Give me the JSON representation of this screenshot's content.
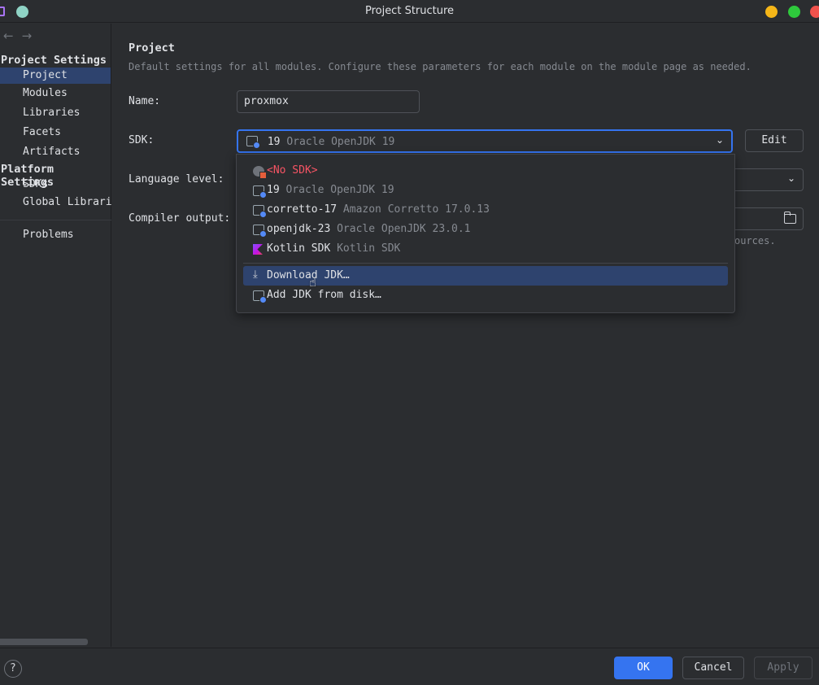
{
  "window": {
    "title": "Project Structure"
  },
  "sidebar": {
    "nav_back": "←",
    "nav_forward": "→",
    "project_settings_header": "Project Settings",
    "project_settings_items": [
      "Project",
      "Modules",
      "Libraries",
      "Facets",
      "Artifacts"
    ],
    "platform_settings_header": "Platform Settings",
    "platform_settings_items": [
      "SDKs",
      "Global Librari"
    ],
    "problems": "Problems",
    "selected": "Project"
  },
  "main": {
    "heading": "Project",
    "description": "Default settings for all modules. Configure these parameters for each module on the module page as needed.",
    "name_label": "Name:",
    "name_value": "proxmox",
    "sdk_label": "SDK:",
    "sdk_value_name": "19",
    "sdk_value_detail": "Oracle OpenJDK 19",
    "edit_label": "Edit",
    "language_level_label": "Language level:",
    "compiler_output_label": "Compiler output:",
    "compiler_output_hint_tail": "ources."
  },
  "sdk_dropdown": {
    "items": [
      {
        "name": "<No SDK>",
        "detail": "",
        "icon": "no-sdk-icon"
      },
      {
        "name": "19",
        "detail": "Oracle OpenJDK 19",
        "icon": "jdk-icon"
      },
      {
        "name": "corretto-17",
        "detail": "Amazon Corretto 17.0.13",
        "icon": "jdk-icon"
      },
      {
        "name": "openjdk-23",
        "detail": "Oracle OpenJDK 23.0.1",
        "icon": "jdk-icon"
      },
      {
        "name": "Kotlin SDK",
        "detail": "Kotlin SDK",
        "icon": "kotlin-icon"
      }
    ],
    "actions": [
      {
        "label": "Download JDK…",
        "icon": "download-icon",
        "highlighted": true
      },
      {
        "label": "Add JDK from disk…",
        "icon": "jdk-icon",
        "highlighted": false
      }
    ]
  },
  "footer": {
    "help": "?",
    "ok": "OK",
    "cancel": "Cancel",
    "apply": "Apply"
  },
  "colors": {
    "background": "#2b2d30",
    "accent": "#3574f0",
    "selection": "#2e436e",
    "error_text": "#f75464"
  }
}
